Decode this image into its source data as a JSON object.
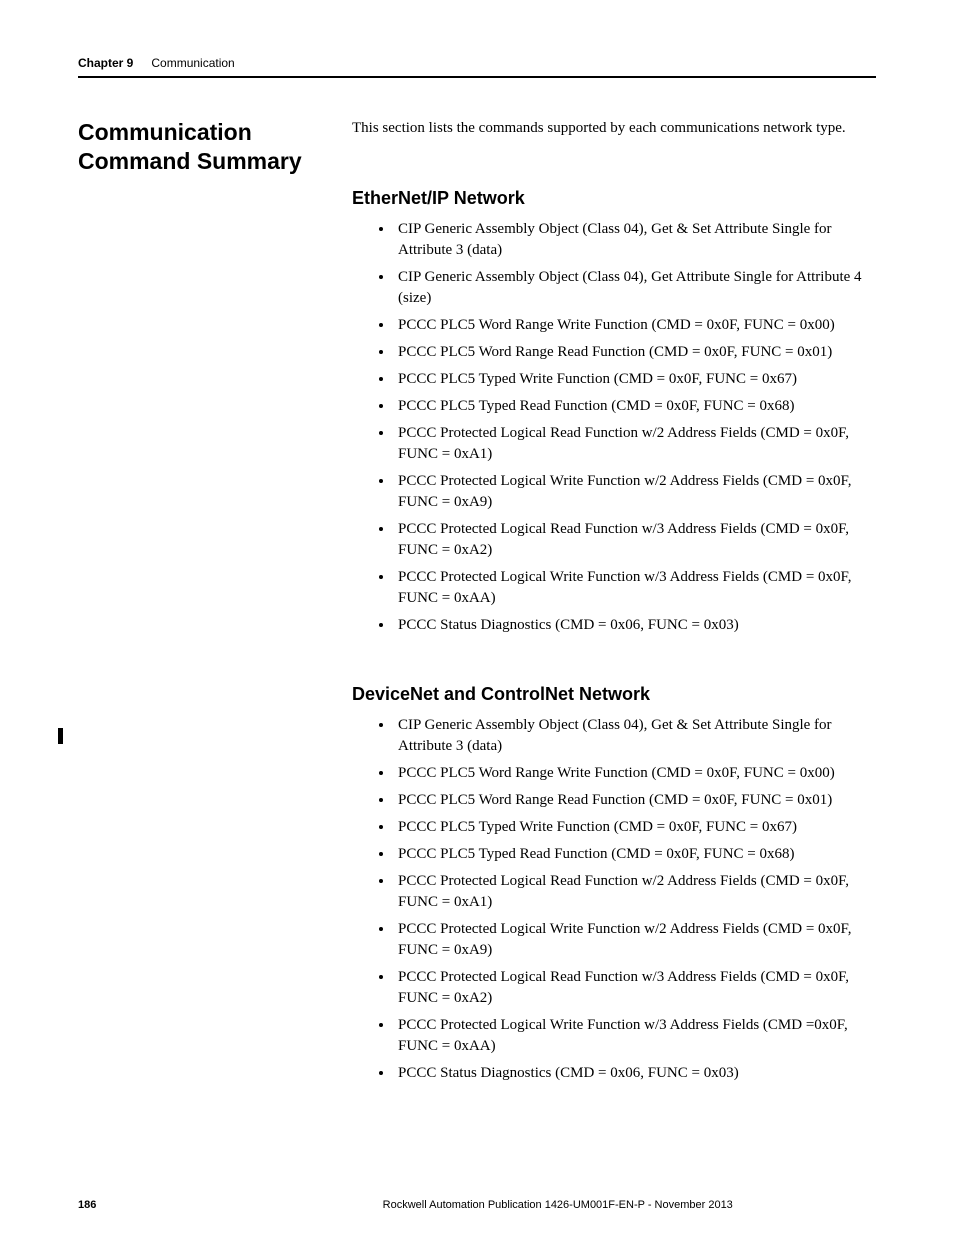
{
  "runningHead": {
    "chapter": "Chapter 9",
    "title": "Communication"
  },
  "sectionHeading": "Communication Command Summary",
  "intro": "This section lists the commands supported by each communications network type.",
  "sub1": {
    "heading": "EtherNet/IP Network",
    "items": [
      "CIP Generic Assembly Object (Class 04), Get & Set Attribute Single for Attribute 3 (data)",
      "CIP Generic Assembly Object (Class 04), Get Attribute Single for Attribute 4 (size)",
      "PCCC PLC5 Word Range Write Function (CMD = 0x0F, FUNC = 0x00)",
      "PCCC PLC5 Word Range Read Function (CMD = 0x0F, FUNC = 0x01)",
      "PCCC PLC5 Typed Write Function (CMD = 0x0F, FUNC = 0x67)",
      "PCCC PLC5 Typed Read Function (CMD = 0x0F, FUNC = 0x68)",
      "PCCC Protected Logical Read Function w/2 Address Fields (CMD = 0x0F, FUNC = 0xA1)",
      "PCCC Protected Logical Write Function w/2 Address Fields (CMD = 0x0F, FUNC = 0xA9)",
      "PCCC Protected Logical Read Function w/3 Address Fields (CMD = 0x0F, FUNC = 0xA2)",
      "PCCC Protected Logical Write Function w/3 Address Fields (CMD = 0x0F, FUNC = 0xAA)",
      "PCCC Status Diagnostics (CMD = 0x06, FUNC = 0x03)"
    ]
  },
  "sub2": {
    "heading": "DeviceNet and ControlNet Network",
    "items": [
      "CIP Generic Assembly Object (Class 04), Get & Set Attribute Single for Attribute 3 (data)",
      "PCCC PLC5 Word Range Write Function (CMD = 0x0F, FUNC = 0x00)",
      "PCCC PLC5 Word Range Read Function (CMD = 0x0F, FUNC = 0x01)",
      "PCCC PLC5 Typed Write Function (CMD = 0x0F, FUNC = 0x67)",
      "PCCC PLC5 Typed Read Function (CMD = 0x0F, FUNC = 0x68)",
      "PCCC Protected Logical Read Function w/2 Address Fields (CMD = 0x0F, FUNC = 0xA1)",
      "PCCC Protected Logical Write Function w/2 Address Fields (CMD = 0x0F, FUNC = 0xA9)",
      "PCCC Protected Logical Read Function w/3 Address Fields (CMD = 0x0F, FUNC = 0xA2)",
      "PCCC Protected Logical Write Function w/3 Address Fields (CMD =0x0F, FUNC = 0xAA)",
      "PCCC Status Diagnostics (CMD = 0x06, FUNC = 0x03)"
    ]
  },
  "footer": {
    "pageNumber": "186",
    "publication": "Rockwell Automation Publication 1426-UM001F-EN-P - November 2013"
  }
}
